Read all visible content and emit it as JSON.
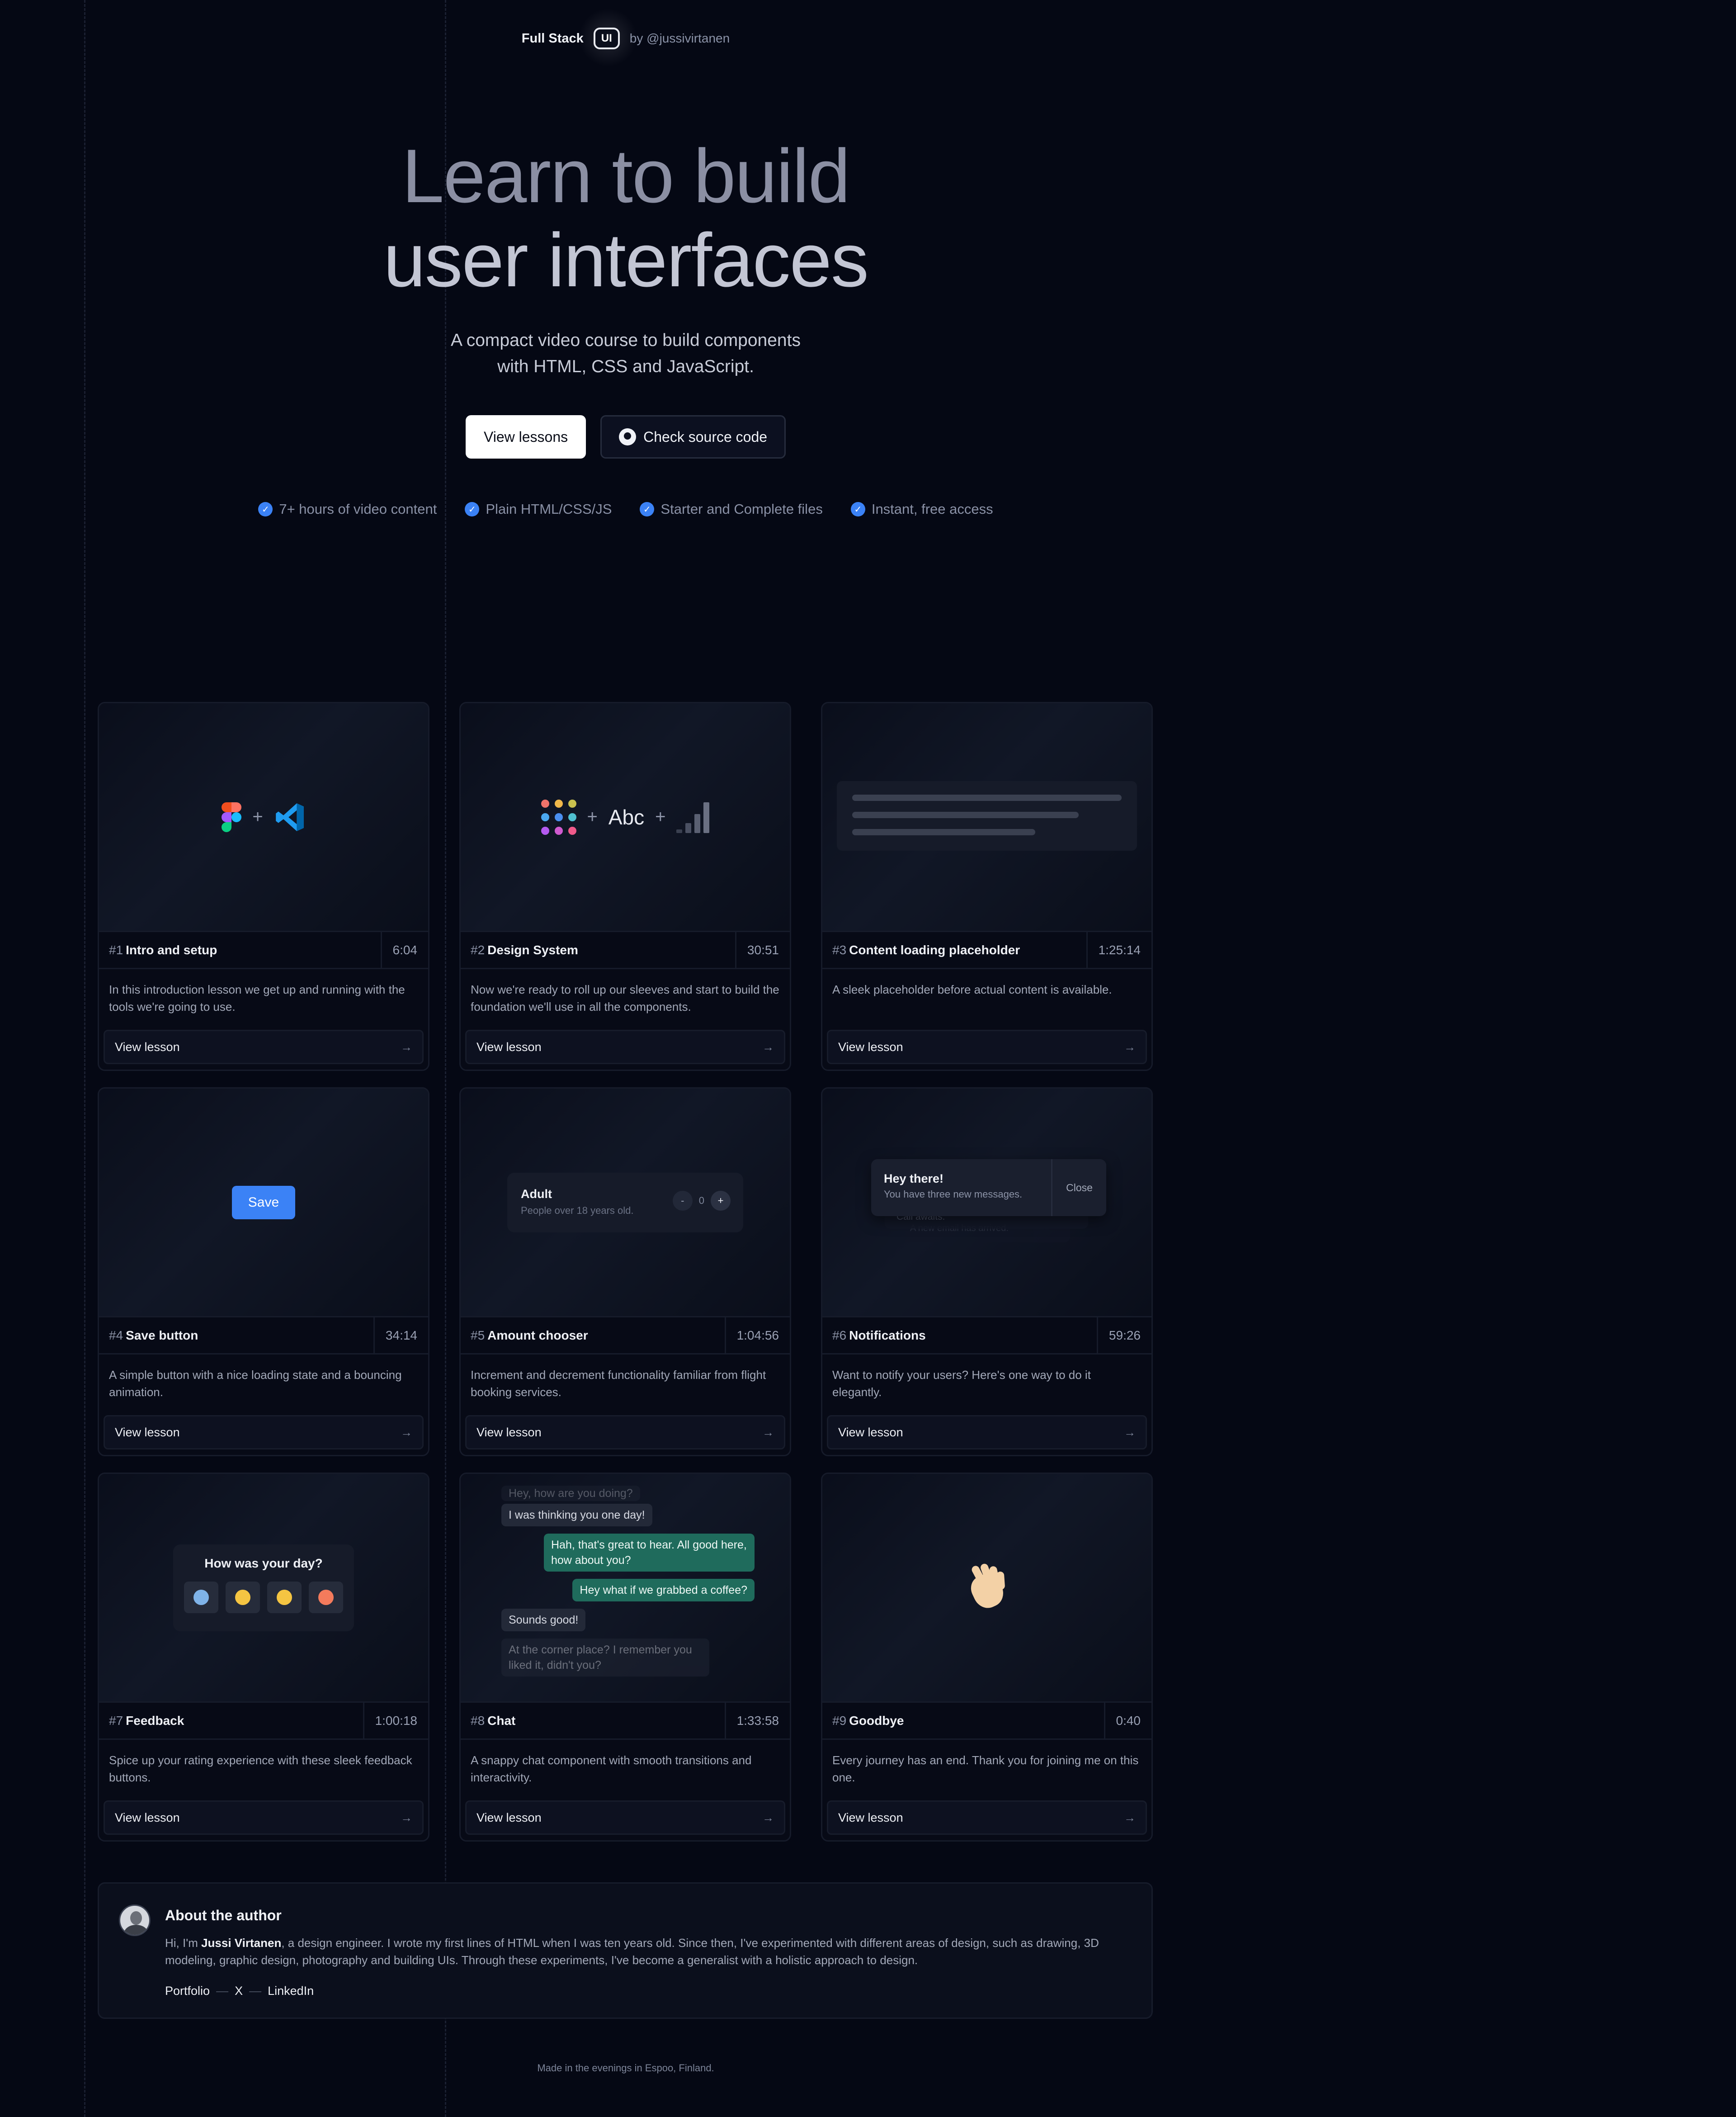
{
  "header": {
    "brand_name": "Full Stack",
    "brand_badge": "UI",
    "byline": "by @jussivirtanen"
  },
  "hero": {
    "title_line1": "Learn to build",
    "title_line2": "user interfaces",
    "subtitle_line1": "A compact video course to build components",
    "subtitle_line2": "with HTML, CSS and JavaScript.",
    "primary_cta": "View lessons",
    "secondary_cta": "Check source code",
    "features": [
      "7+ hours of video content",
      "Plain HTML/CSS/JS",
      "Starter and Complete files",
      "Instant, free access"
    ]
  },
  "lessons": [
    {
      "num": "#1",
      "title": "Intro and setup",
      "duration": "6:04",
      "desc": "In this introduction lesson we get up and running with the tools we're going to use.",
      "cta": "View lesson"
    },
    {
      "num": "#2",
      "title": "Design System",
      "duration": "30:51",
      "desc": "Now we're ready to roll up our sleeves and start to build the foundation we'll use in all the components.",
      "cta": "View lesson"
    },
    {
      "num": "#3",
      "title": "Content loading placeholder",
      "duration": "1:25:14",
      "desc": "A sleek placeholder before actual content is available.",
      "cta": "View lesson"
    },
    {
      "num": "#4",
      "title": "Save button",
      "duration": "34:14",
      "desc": "A simple button with a nice loading state and a bouncing animation.",
      "cta": "View lesson"
    },
    {
      "num": "#5",
      "title": "Amount chooser",
      "duration": "1:04:56",
      "desc": "Increment and decrement functionality familiar from flight booking services.",
      "cta": "View lesson"
    },
    {
      "num": "#6",
      "title": "Notifications",
      "duration": "59:26",
      "desc": "Want to notify your users? Here's one way to do it elegantly.",
      "cta": "View lesson"
    },
    {
      "num": "#7",
      "title": "Feedback",
      "duration": "1:00:18",
      "desc": "Spice up your rating experience with these sleek feedback buttons.",
      "cta": "View lesson"
    },
    {
      "num": "#8",
      "title": "Chat",
      "duration": "1:33:58",
      "desc": "A snappy chat component with smooth transitions and interactivity.",
      "cta": "View lesson"
    },
    {
      "num": "#9",
      "title": "Goodbye",
      "duration": "0:40",
      "desc": "Every journey has an end. Thank you for joining me on this one.",
      "cta": "View lesson"
    }
  ],
  "previews": {
    "design_text": "Abc",
    "save_label": "Save",
    "amount_title": "Adult",
    "amount_sub": "People over 18 years old.",
    "amount_minus": "-",
    "amount_value": "0",
    "amount_plus": "+",
    "notif_title": "Hey there!",
    "notif_text": "You have three new messages.",
    "notif_close": "Close",
    "notif_back1": "Call awaits.",
    "notif_back2": "A new email has arrived.",
    "feedback_title": "How was your day?",
    "chat": [
      "Hey, how are you doing?",
      "I was thinking you one day!",
      "Hah, that's great to hear. All good here, how about you?",
      "Hey what if we grabbed a coffee?",
      "Sounds good!",
      "At the corner place? I remember you liked it, didn't you?"
    ]
  },
  "about": {
    "title": "About the author",
    "greeting": "Hi, I'm ",
    "name": "Jussi Virtanen",
    "bio": ", a design engineer. I wrote my first lines of HTML when I was ten years old. Since then, I've experimented with different areas of design, such as drawing, 3D modeling, graphic design, photography and building UIs. Through these experiments, I've become a generalist with a holistic approach to design.",
    "links": [
      "Portfolio",
      "X",
      "LinkedIn"
    ],
    "separator": "—"
  },
  "footer": {
    "text": "Made in the evenings in Espoo, Finland."
  },
  "colors": {
    "background": "#050814",
    "accent": "#3b82f6",
    "chat_out": "#1f6b5c"
  }
}
